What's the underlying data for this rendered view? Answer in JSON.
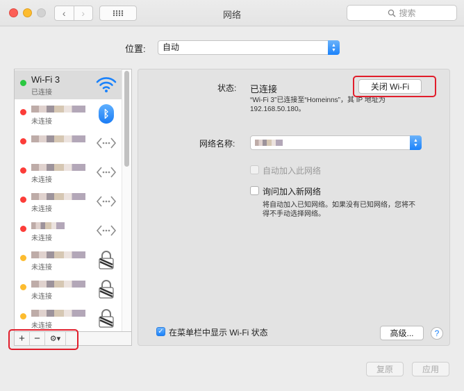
{
  "window": {
    "title": "网络"
  },
  "toolbar": {
    "back_icon": "‹",
    "forward_icon": "›",
    "grid_icon": "grid-icon",
    "search_placeholder": "搜索"
  },
  "location": {
    "label": "位置:",
    "value": "自动"
  },
  "networks": [
    {
      "name": "Wi-Fi 3",
      "status": "已连接",
      "dot_color": "#2bc841",
      "icon": "wifi-icon",
      "selected": true
    },
    {
      "name": "",
      "status": "未连接",
      "dot_color": "#fc3d39",
      "icon": "bluetooth-icon"
    },
    {
      "name": "",
      "status": "",
      "dot_color": "#fc3d39",
      "icon": "ethernet-icon"
    },
    {
      "name": "",
      "status": "未连接",
      "dot_color": "#fc3d39",
      "icon": "ethernet-icon"
    },
    {
      "name": "",
      "status": "未连接",
      "dot_color": "#fc3d39",
      "icon": "ethernet-icon"
    },
    {
      "name": "",
      "status": "未连接",
      "dot_color": "#fc3d39",
      "icon": "ethernet-icon"
    },
    {
      "name": "",
      "status": "未连接",
      "dot_color": "#fdbc2f",
      "icon": "lock-icon"
    },
    {
      "name": "",
      "status": "未连接",
      "dot_color": "#fdbc2f",
      "icon": "lock-icon"
    },
    {
      "name": "",
      "status": "未连接",
      "dot_color": "#fdbc2f",
      "icon": "lock-icon"
    }
  ],
  "list_footer": {
    "add": "+",
    "remove": "−",
    "gear": "⚙︎▾"
  },
  "detail": {
    "status_label": "状态:",
    "status_value": "已连接",
    "turn_off_button": "关闭 Wi-Fi",
    "status_desc_1": "“Wi-Fi 3”已连接至“Homeinns”，其 IP 地址为",
    "status_desc_2": "192.168.50.180。",
    "network_name_label": "网络名称:",
    "auto_join_label": "自动加入此网络",
    "ask_join_label": "询问加入新网络",
    "ask_join_desc_1": "将自动加入已知网络。如果没有已知网络，您将不",
    "ask_join_desc_2": "得不手动选择网络。",
    "show_menubar_label": "在菜单栏中显示 Wi-Fi 状态",
    "advanced_button": "高级...",
    "help_button": "?"
  },
  "bottom": {
    "revert_button": "复原",
    "apply_button": "应用"
  },
  "colors": {
    "accent": "#1a82fb",
    "highlight": "#e11d2b",
    "connected": "#2bc841"
  }
}
